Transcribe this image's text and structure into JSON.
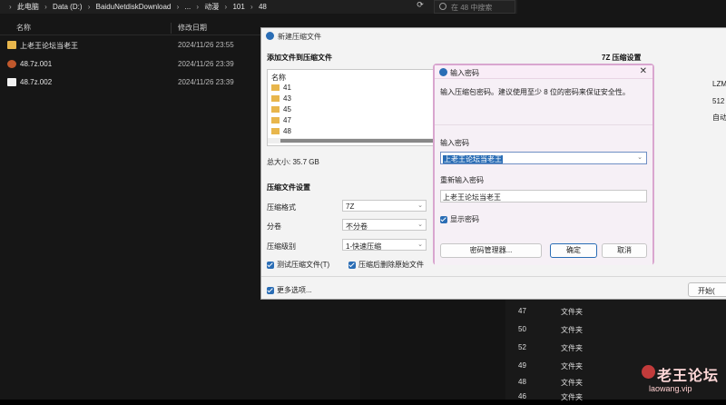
{
  "explorer": {
    "breadcrumb": [
      "此电脑",
      "Data (D:)",
      "BaiduNetdiskDownload",
      "...",
      "动漫",
      "101",
      "48"
    ],
    "search_placeholder": "在 48 中搜索",
    "columns": {
      "name": "名称",
      "date": "修改日期"
    },
    "files": [
      {
        "name": "上老王论坛当老王",
        "date": "2024/11/26 23:55",
        "icon": "folder-icon"
      },
      {
        "name": "48.7z.001",
        "date": "2024/11/26 23:39",
        "icon": "archive-icon"
      },
      {
        "name": "48.7z.002",
        "date": "2024/11/26 23:39",
        "icon": "file-icon"
      }
    ],
    "right_rows": [
      {
        "num": "47",
        "type": "文件夹"
      },
      {
        "num": "50",
        "type": "文件夹"
      },
      {
        "num": "52",
        "type": "文件夹"
      },
      {
        "num": "49",
        "type": "文件夹"
      },
      {
        "num": "48",
        "type": "文件夹"
      },
      {
        "num": "46",
        "type": "文件夹"
      }
    ]
  },
  "compress_dialog": {
    "title": "新建压缩文件",
    "section_add": "添加文件到压缩文件",
    "list_header": "名称",
    "list_items": [
      "41",
      "43",
      "45",
      "47",
      "48"
    ],
    "total_size": "总大小: 35.7 GB",
    "section_settings": "压缩文件设置",
    "format_label": "压缩格式",
    "format_value": "7Z",
    "split_label": "分卷",
    "split_value": "不分卷",
    "level_label": "压缩级别",
    "level_value": "1-快速压缩",
    "test_label": "测试压缩文件(T)",
    "delete_label": "压缩后删除原始文件",
    "more_options_label": "更多选项...",
    "right_section_title": "7Z 压缩设置",
    "right_values": [
      "LZM",
      "512",
      "自动"
    ],
    "start_button": "开始("
  },
  "password_dialog": {
    "title": "输入密码",
    "info": "输入压缩包密码。建议使用至少 8 位的密码来保证安全性。",
    "password_label": "输入密码",
    "password_value": "上老王论坛当老王",
    "confirm_label": "重新输入密码",
    "confirm_value": "上老王论坛当老王",
    "show_password_label": "显示密码",
    "manager_button": "密码管理器...",
    "ok_button": "确定",
    "cancel_button": "取消"
  },
  "watermark": {
    "line1": "老王论坛",
    "line2": "laowang.vip"
  }
}
